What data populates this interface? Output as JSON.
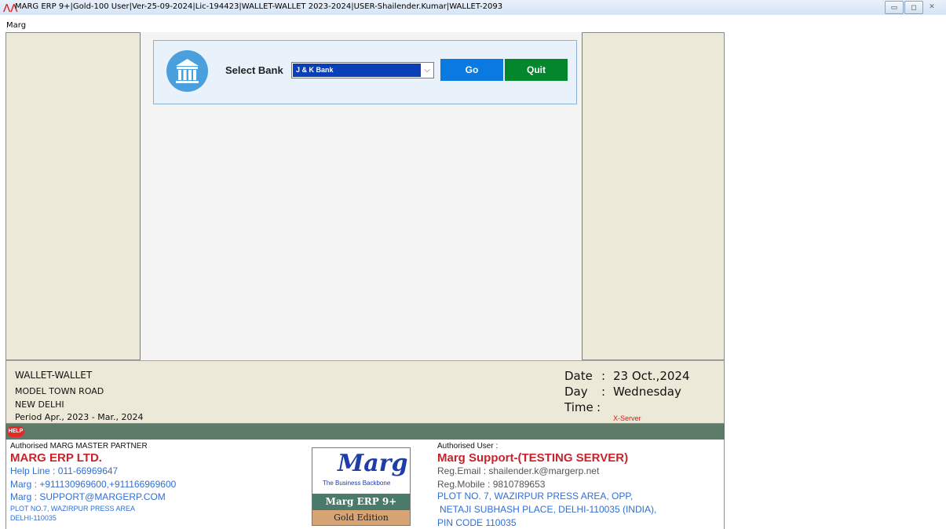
{
  "window": {
    "title": "MARG ERP 9+|Gold-100 User|Ver-25-09-2024|Lic-194423|WALLET-WALLET 2023-2024|USER-Shailender.Kumar|WALLET-2093",
    "minimize": "▭",
    "maximize": "◻",
    "close": "✕"
  },
  "menu": {
    "item": "Marg"
  },
  "bank": {
    "label": "Select Bank",
    "selected": "J & K Bank",
    "go": "Go",
    "quit": "Quit"
  },
  "company": {
    "name": "WALLET-WALLET",
    "address1": "MODEL TOWN ROAD",
    "address2": "NEW DELHI",
    "period": "Period Apr., 2023 - Mar., 2024"
  },
  "datetime": {
    "date_label": "Date",
    "date": "23 Oct.,2024",
    "day_label": "Day",
    "day": "Wednesday",
    "time_label": "Time",
    "server": "X-Server"
  },
  "help": {
    "label": "HELP"
  },
  "partner": {
    "heading": "Authorised MARG MASTER PARTNER",
    "name": "MARG ERP LTD.",
    "helpline": "Help Line : 011-66969647",
    "phone": "Marg : +911130969600,+911166969600",
    "email": "Marg : SUPPORT@MARGERP.COM",
    "address1": "PLOT NO.7, WAZIRPUR PRESS AREA",
    "address2": "DELHI-110035"
  },
  "logo": {
    "brand": "Marg",
    "tagline": "The Business Backbone",
    "edition": "Marg ERP 9+",
    "gold": "Gold Edition"
  },
  "user": {
    "heading": "Authorised User :",
    "name": "Marg Support-(TESTING SERVER)",
    "email": "Reg.Email : shailender.k@margerp.net",
    "mobile": "Reg.Mobile : 9810789653",
    "address1": "PLOT NO. 7, WAZIRPUR PRESS AREA, OPP,",
    "address2": "NETAJI SUBHASH PLACE, DELHI-110035 (INDIA),",
    "address3": "PIN CODE 110035"
  },
  "colors": {
    "go": "#0a7ae0",
    "quit": "#04862d",
    "accent_red": "#c8232b",
    "link_blue": "#2f6fd6"
  }
}
